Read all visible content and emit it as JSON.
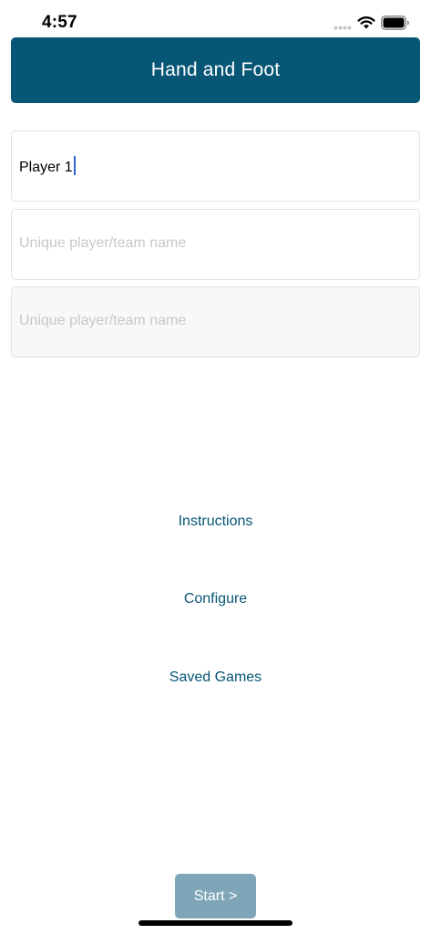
{
  "status_bar": {
    "time": "4:57"
  },
  "header": {
    "title": "Hand and Foot"
  },
  "players": [
    {
      "value": "Player 1",
      "placeholder": "Unique player/team name",
      "focused": true,
      "enabled": true
    },
    {
      "value": "",
      "placeholder": "Unique player/team name",
      "focused": false,
      "enabled": true
    },
    {
      "value": "",
      "placeholder": "Unique player/team name",
      "focused": false,
      "enabled": false
    }
  ],
  "menu": {
    "instructions": "Instructions",
    "configure": "Configure",
    "saved_games": "Saved Games"
  },
  "start_button": {
    "label": "Start >"
  },
  "colors": {
    "accent": "#075675",
    "start_button_disabled": "#7fa6b8",
    "caret": "#2f63d8",
    "placeholder": "#c8c8cc"
  },
  "icons": [
    "signal-dots-icon",
    "wifi-icon",
    "battery-icon"
  ]
}
